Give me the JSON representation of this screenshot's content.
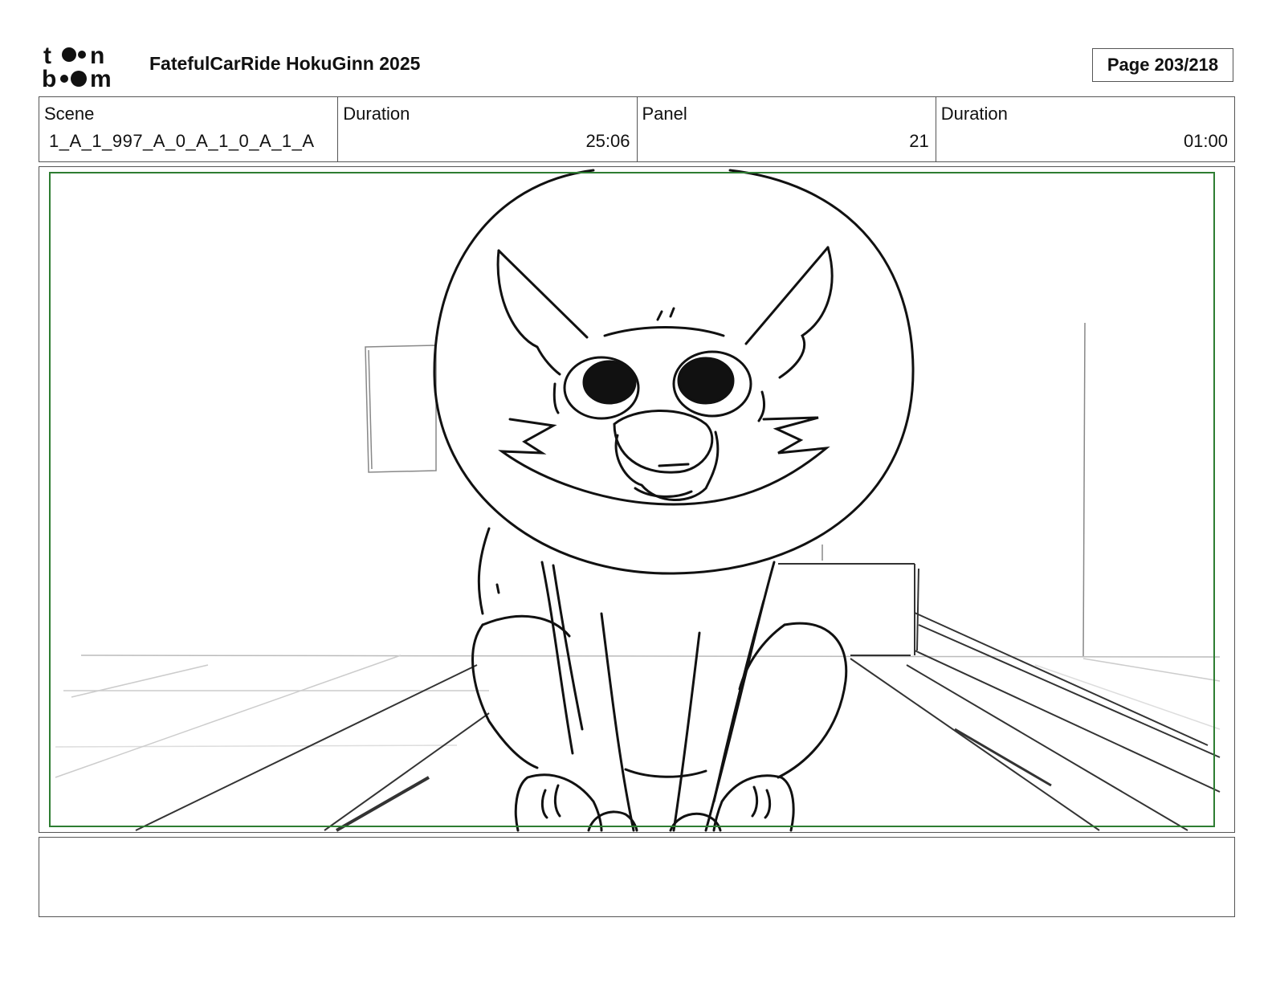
{
  "header": {
    "logo_text": "toon boom",
    "title": "FatefulCarRide HokuGinn 2025",
    "page_indicator": "Page 203/218"
  },
  "info": {
    "scene_label": "Scene",
    "scene_value": "1_A_1_997_A_0_A_1_0_A_1_A",
    "scene_duration_label": "Duration",
    "scene_duration_value": "25:06",
    "panel_label": "Panel",
    "panel_value": "21",
    "panel_duration_label": "Duration",
    "panel_duration_value": "01:00"
  },
  "panel": {
    "safe_frame_color": "#2e7d32",
    "content": "character-sketch"
  },
  "notes": {
    "text": ""
  }
}
